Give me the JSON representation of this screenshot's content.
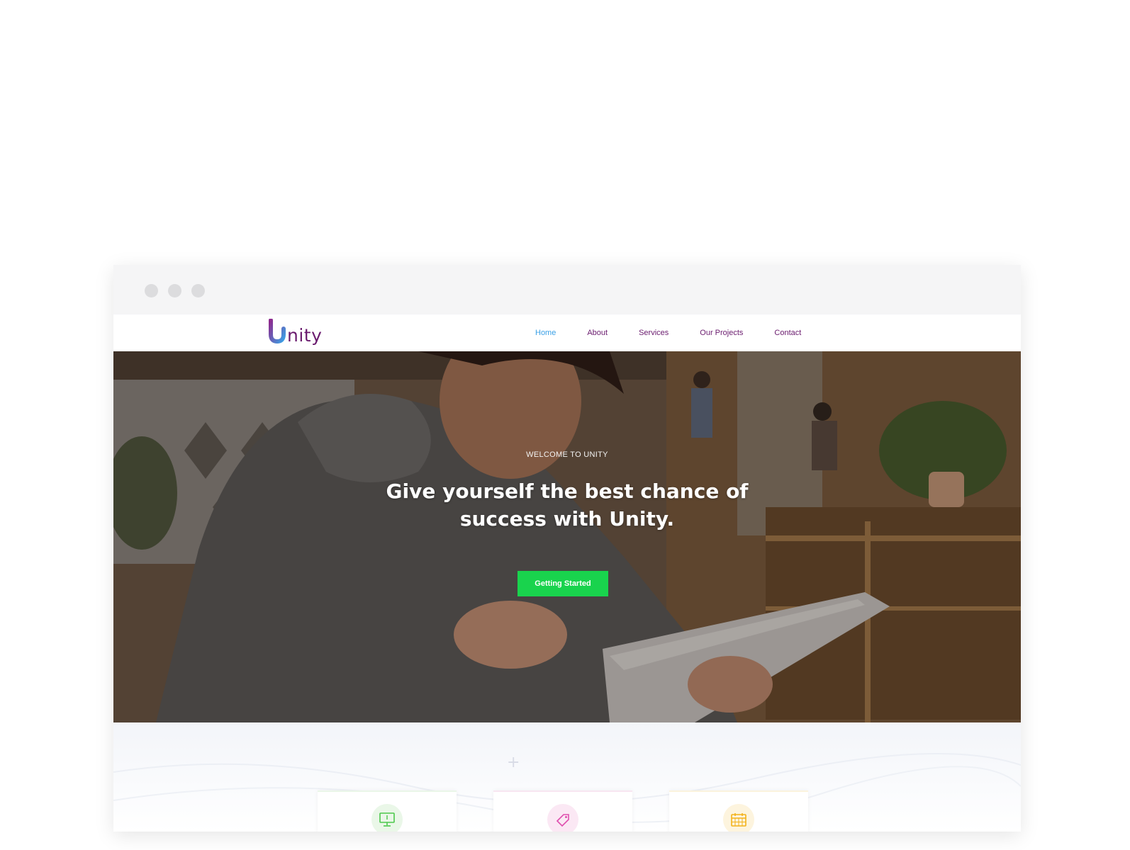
{
  "window": {
    "controls": [
      "close",
      "minimize",
      "maximize"
    ]
  },
  "brand": {
    "logo_letter": "U",
    "logo_text": "nity",
    "colors": {
      "primary": "#6a1b6e",
      "gradient_start": "#8e2b8f",
      "gradient_end": "#3aa0e6"
    }
  },
  "nav": {
    "items": [
      {
        "label": "Home",
        "active": true
      },
      {
        "label": "About",
        "active": false
      },
      {
        "label": "Services",
        "active": false
      },
      {
        "label": "Our Projects",
        "active": false
      },
      {
        "label": "Contact",
        "active": false
      }
    ],
    "active_color": "#3aa0e6"
  },
  "hero": {
    "eyebrow": "WELCOME TO UNITY",
    "headline_line1": "Give yourself the best chance of",
    "headline_line2": "success with Unity.",
    "cta_label": "Getting Started",
    "cta_color": "#19d34d"
  },
  "features": {
    "cards": [
      {
        "icon": "monitor-icon",
        "accent": "#4cc94c"
      },
      {
        "icon": "tag-icon",
        "accent": "#e04fae"
      },
      {
        "icon": "calendar-icon",
        "accent": "#f3b21a"
      }
    ]
  }
}
